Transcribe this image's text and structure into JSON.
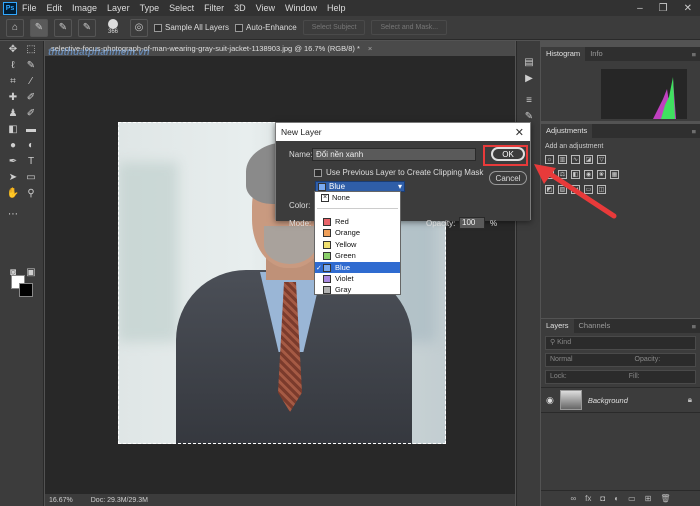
{
  "menubar": {
    "logo": "Ps",
    "items": [
      "File",
      "Edit",
      "Image",
      "Layer",
      "Type",
      "Select",
      "Filter",
      "3D",
      "View",
      "Window",
      "Help"
    ],
    "window_controls": [
      "–",
      "❐",
      "✕"
    ]
  },
  "options_bar": {
    "brush_size": "366",
    "sample_all_layers": "Sample All Layers",
    "auto_enhance": "Auto-Enhance",
    "select_subject": "Select Subject",
    "select_and_mask": "Select and Mask..."
  },
  "document": {
    "tab_title": "selective-focus-photograph-of-man-wearing-gray-suit-jacket-1138903.jpg @ 16.7% (RGB/8) *",
    "tab_close": "×",
    "watermark": "thuthuatphanmem.vn",
    "zoom": "16.67%",
    "doc_size": "Doc: 29.3M/29.3M"
  },
  "panels": {
    "histogram_tab": "Histogram",
    "info_tab": "Info",
    "adjustments_tab": "Adjustments",
    "add_adjustment": "Add an adjustment",
    "layers_tab": "Layers",
    "channels_tab": "Channels",
    "kind_filter": "Kind",
    "blend_mode": "Normal",
    "opacity_label": "Opacity:",
    "lock_label": "Lock:",
    "fill_label": "Fill:",
    "layer_name": "Background"
  },
  "dialog": {
    "title": "New Layer",
    "close": "✕",
    "name_label": "Name:",
    "name_value": "Đổi nền xanh",
    "clipping_mask_label": "Use Previous Layer to Create Clipping Mask",
    "color_label": "Color:",
    "color_value": "Blue",
    "mode_label": "Mode:",
    "opacity_label": "Opacity:",
    "opacity_value": "100",
    "opacity_unit": "%",
    "ok_label": "OK",
    "cancel_label": "Cancel"
  },
  "color_dropdown": {
    "none_label": "None",
    "options": [
      {
        "label": "Red",
        "color": "#e8646a"
      },
      {
        "label": "Orange",
        "color": "#f0a05a"
      },
      {
        "label": "Yellow",
        "color": "#f0e070"
      },
      {
        "label": "Green",
        "color": "#8ad06a"
      },
      {
        "label": "Blue",
        "color": "#7aaaf0",
        "selected": true
      },
      {
        "label": "Violet",
        "color": "#a888e0"
      },
      {
        "label": "Gray",
        "color": "#b0b0b0"
      }
    ]
  },
  "colors": {
    "accent_highlight": "#e83a3a",
    "selection_blue": "#2f6bd0"
  }
}
